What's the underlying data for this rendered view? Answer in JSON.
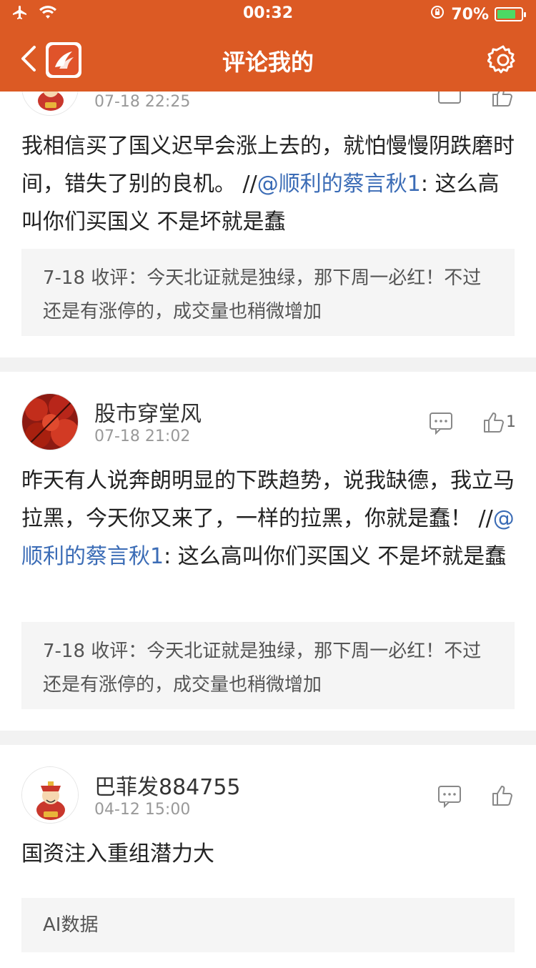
{
  "status_bar": {
    "time": "00:32",
    "battery": "70%"
  },
  "header": {
    "title": "评论我的"
  },
  "posts": [
    {
      "user": "",
      "time": "07-18 22:25",
      "content": "我相信买了国义迟早会涨上去的，就怕慢慢阴跌磨时间，错失了别的良机。 //",
      "mention": "@顺利的蔡言秋1",
      "content_after": ": 这么高叫你们买国义 不是坏就是蠢",
      "quote": "7-18 收评：今天北证就是独绿，那下周一必红！不过还是有涨停的，成交量也稍微增加",
      "like_count": ""
    },
    {
      "user": "股市穿堂风",
      "time": "07-18 21:02",
      "content": "昨天有人说奔朗明显的下跌趋势，说我缺德，我立马拉黑，今天你又来了，一样的拉黑，你就是蠢！ //",
      "mention": "@顺利的蔡言秋1",
      "content_after": ": 这么高叫你们买国义 不是坏就是蠢",
      "quote": "7-18 收评：今天北证就是独绿，那下周一必红！不过还是有涨停的，成交量也稍微增加",
      "like_count": "1"
    },
    {
      "user": "巴菲发884755",
      "time": "04-12 15:00",
      "content": "国资注入重组潜力大",
      "quote": "AI数据",
      "like_count": ""
    }
  ]
}
